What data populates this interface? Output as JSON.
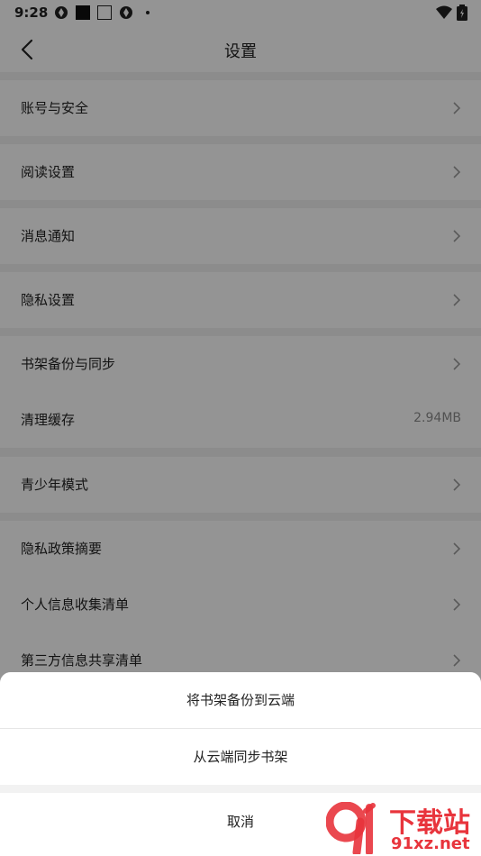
{
  "status_bar": {
    "time": "9:28"
  },
  "nav": {
    "title": "设置"
  },
  "settings": [
    {
      "label": "账号与安全",
      "value": ""
    },
    {
      "label": "阅读设置",
      "value": ""
    },
    {
      "label": "消息通知",
      "value": ""
    },
    {
      "label": "隐私设置",
      "value": ""
    },
    {
      "label": "书架备份与同步",
      "value": ""
    },
    {
      "label": "清理缓存",
      "value": "2.94MB"
    },
    {
      "label": "青少年模式",
      "value": ""
    },
    {
      "label": "隐私政策摘要",
      "value": ""
    },
    {
      "label": "个人信息收集清单",
      "value": ""
    },
    {
      "label": "第三方信息共享清单",
      "value": ""
    }
  ],
  "sheet": {
    "backup_label": "将书架备份到云端",
    "sync_label": "从云端同步书架",
    "cancel_label": "取消"
  },
  "watermark": {
    "brand": "下载站",
    "domain": "91xz.net"
  },
  "colors": {
    "accent": "#e8343c",
    "text": "#222222",
    "secondary": "#8c8c8c"
  }
}
